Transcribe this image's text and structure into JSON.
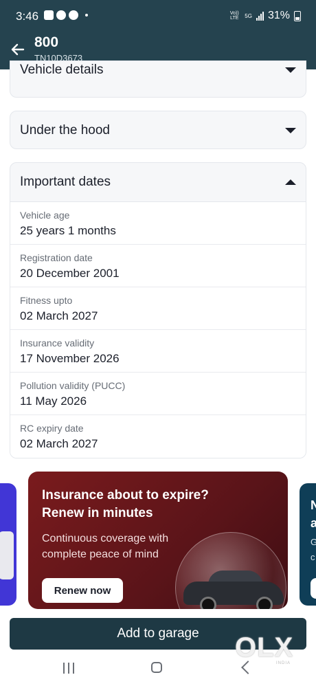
{
  "status_bar": {
    "time": "3:46",
    "network": "Vo)) LTE",
    "network_type": "5G",
    "battery_percent": "31%"
  },
  "header": {
    "title": "800",
    "subtitle": "TN10D3673"
  },
  "sections": {
    "vehicle_details": "Vehicle details",
    "under_the_hood": "Under the hood",
    "important_dates": "Important dates"
  },
  "dates": [
    {
      "label": "Vehicle age",
      "value": "25 years 1 months"
    },
    {
      "label": "Registration date",
      "value": "20 December 2001"
    },
    {
      "label": "Fitness upto",
      "value": "02 March 2027"
    },
    {
      "label": "Insurance validity",
      "value": "17 November 2026"
    },
    {
      "label": "Pollution validity (PUCC)",
      "value": "11 May 2026"
    },
    {
      "label": "RC expiry date",
      "value": "02 March 2027"
    }
  ],
  "banner": {
    "title": "Insurance about to expire? Renew in minutes",
    "subtitle": "Continuous coverage with complete peace of mind",
    "button": "Renew now"
  },
  "banner_right_peek": {
    "line1": "N",
    "line2": "a",
    "line3": "G",
    "line4": "c"
  },
  "footer": {
    "add_to_garage": "Add to garage"
  },
  "watermark": {
    "text": "OLX",
    "small": "INDIA"
  },
  "colors": {
    "header_bg": "#25434f",
    "button_bg": "#1e3944",
    "banner_bg": "#6a171b",
    "left_banner_bg": "#4136d6",
    "right_banner_bg": "#0f3e57"
  }
}
